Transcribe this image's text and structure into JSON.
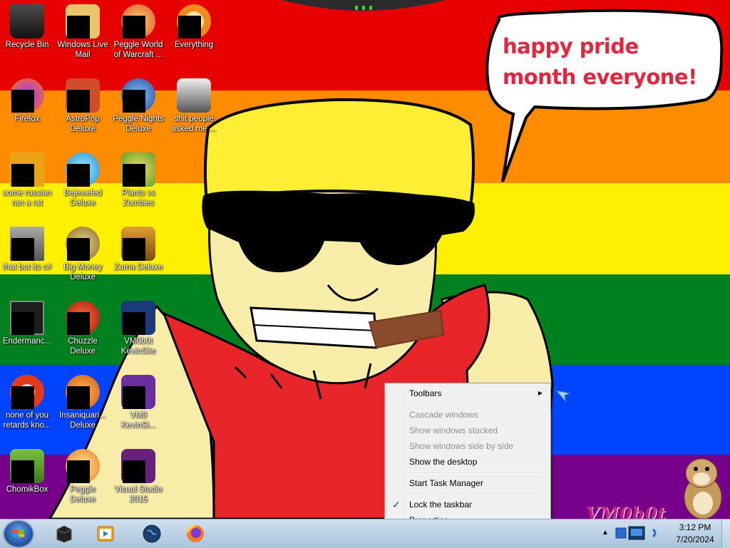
{
  "desktop": {
    "bubble_text": "happy pride month everyone!",
    "watermark": "VM0b0t",
    "flag_colors": [
      "#e70000",
      "#ff8c00",
      "#ffef00",
      "#00811f",
      "#0044ff",
      "#760089"
    ],
    "icons": [
      {
        "label": "Recycle Bin",
        "icon": "recycle-bin-icon"
      },
      {
        "label": "Windows Live Mail",
        "icon": "mail-icon"
      },
      {
        "label": "Peggle World of Warcraft ...",
        "icon": "peggle-icon"
      },
      {
        "label": "Everything",
        "icon": "search-icon"
      },
      {
        "label": "Firefox",
        "icon": "firefox-icon"
      },
      {
        "label": "AstroPop Deluxe",
        "icon": "game-icon"
      },
      {
        "label": "Peggle Nights Deluxe",
        "icon": "peggle-icon"
      },
      {
        "label": "shit people asked me ...",
        "icon": "folder-icon"
      },
      {
        "label": "some russian ran a rat",
        "icon": "program-icon"
      },
      {
        "label": "Bejeweled Deluxe",
        "icon": "gem-icon"
      },
      {
        "label": "Plants vs Zombies",
        "icon": "plant-icon"
      },
      {
        "label": "that but its c#",
        "icon": "window-icon"
      },
      {
        "label": "Big Money Deluxe",
        "icon": "money-icon"
      },
      {
        "label": "Zuma Deluxe",
        "icon": "zuma-icon"
      },
      {
        "label": "Endermanc...",
        "icon": "terminal-icon"
      },
      {
        "label": "Chuzzle Deluxe",
        "icon": "chuzzle-icon"
      },
      {
        "label": "VM0b0t KevinSite",
        "icon": "vs-icon"
      },
      {
        "label": "none of you retards kno...",
        "icon": "program-icon"
      },
      {
        "label": "Insaniquari... Deluxe",
        "icon": "fish-icon"
      },
      {
        "label": "VM0 KevinSi...",
        "icon": "vs-icon"
      },
      {
        "label": "ChomikBox",
        "icon": "hamster-icon"
      },
      {
        "label": "Peggle Deluxe",
        "icon": "peggle-icon"
      },
      {
        "label": "Visual Studio 2015",
        "icon": "visual-studio-icon"
      }
    ]
  },
  "context_menu": {
    "items": [
      {
        "label": "Toolbars",
        "enabled": true,
        "submenu": true
      },
      {
        "label": "Cascade windows",
        "enabled": false
      },
      {
        "label": "Show windows stacked",
        "enabled": false
      },
      {
        "label": "Show windows side by side",
        "enabled": false
      },
      {
        "label": "Show the desktop",
        "enabled": true
      },
      {
        "label": "Start Task Manager",
        "enabled": true
      },
      {
        "label": "Lock the taskbar",
        "enabled": true,
        "checked": true
      },
      {
        "label": "Properties",
        "enabled": true
      }
    ]
  },
  "taskbar": {
    "pinned": [
      "cube-icon",
      "media-player-icon",
      "globe-icon",
      "firefox-icon"
    ],
    "clock": {
      "time": "3:12 PM",
      "date": "7/20/2024"
    },
    "tray_arrow": "▲"
  }
}
